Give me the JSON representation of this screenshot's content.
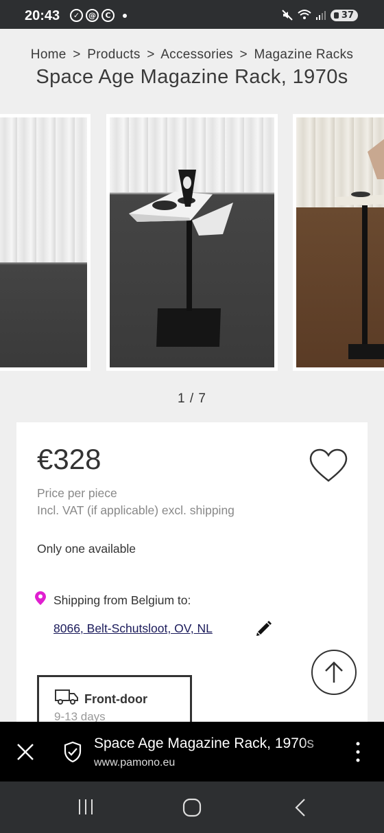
{
  "status_bar": {
    "time": "20:43",
    "battery": "37",
    "left_icons": [
      "check-circle-icon",
      "at-circle-icon",
      "c-circle-icon",
      "notification-dot"
    ],
    "right_icons": [
      "mute-icon",
      "wifi-icon",
      "signal-icon",
      "battery-icon"
    ]
  },
  "breadcrumb": {
    "items": [
      "Home",
      "Products",
      "Accessories",
      "Magazine Racks"
    ],
    "separator": ">"
  },
  "product": {
    "title": "Space Age Magazine Rack, 1970s",
    "price": "€328",
    "price_note": "Price per piece",
    "vat_note": "Incl. VAT (if applicable) excl. shipping",
    "availability": "Only one available"
  },
  "gallery": {
    "pager": "1 / 7"
  },
  "shipping": {
    "from_label": "Shipping from Belgium to:",
    "destination": "8066, Belt-Schutsloot, OV, NL"
  },
  "delivery": {
    "title": "Front-door",
    "time": "9-13 days"
  },
  "browser_bar": {
    "title": "Space Age Magazine Rack, 1970s",
    "url": "www.pamono.eu"
  },
  "colors": {
    "status_bar_bg": "#2d2f31",
    "page_bg": "#efefef",
    "card_bg": "#ffffff",
    "pin_magenta": "#e01fd0",
    "link_navy": "#1a1a5a",
    "browser_bar_bg": "#000000"
  }
}
